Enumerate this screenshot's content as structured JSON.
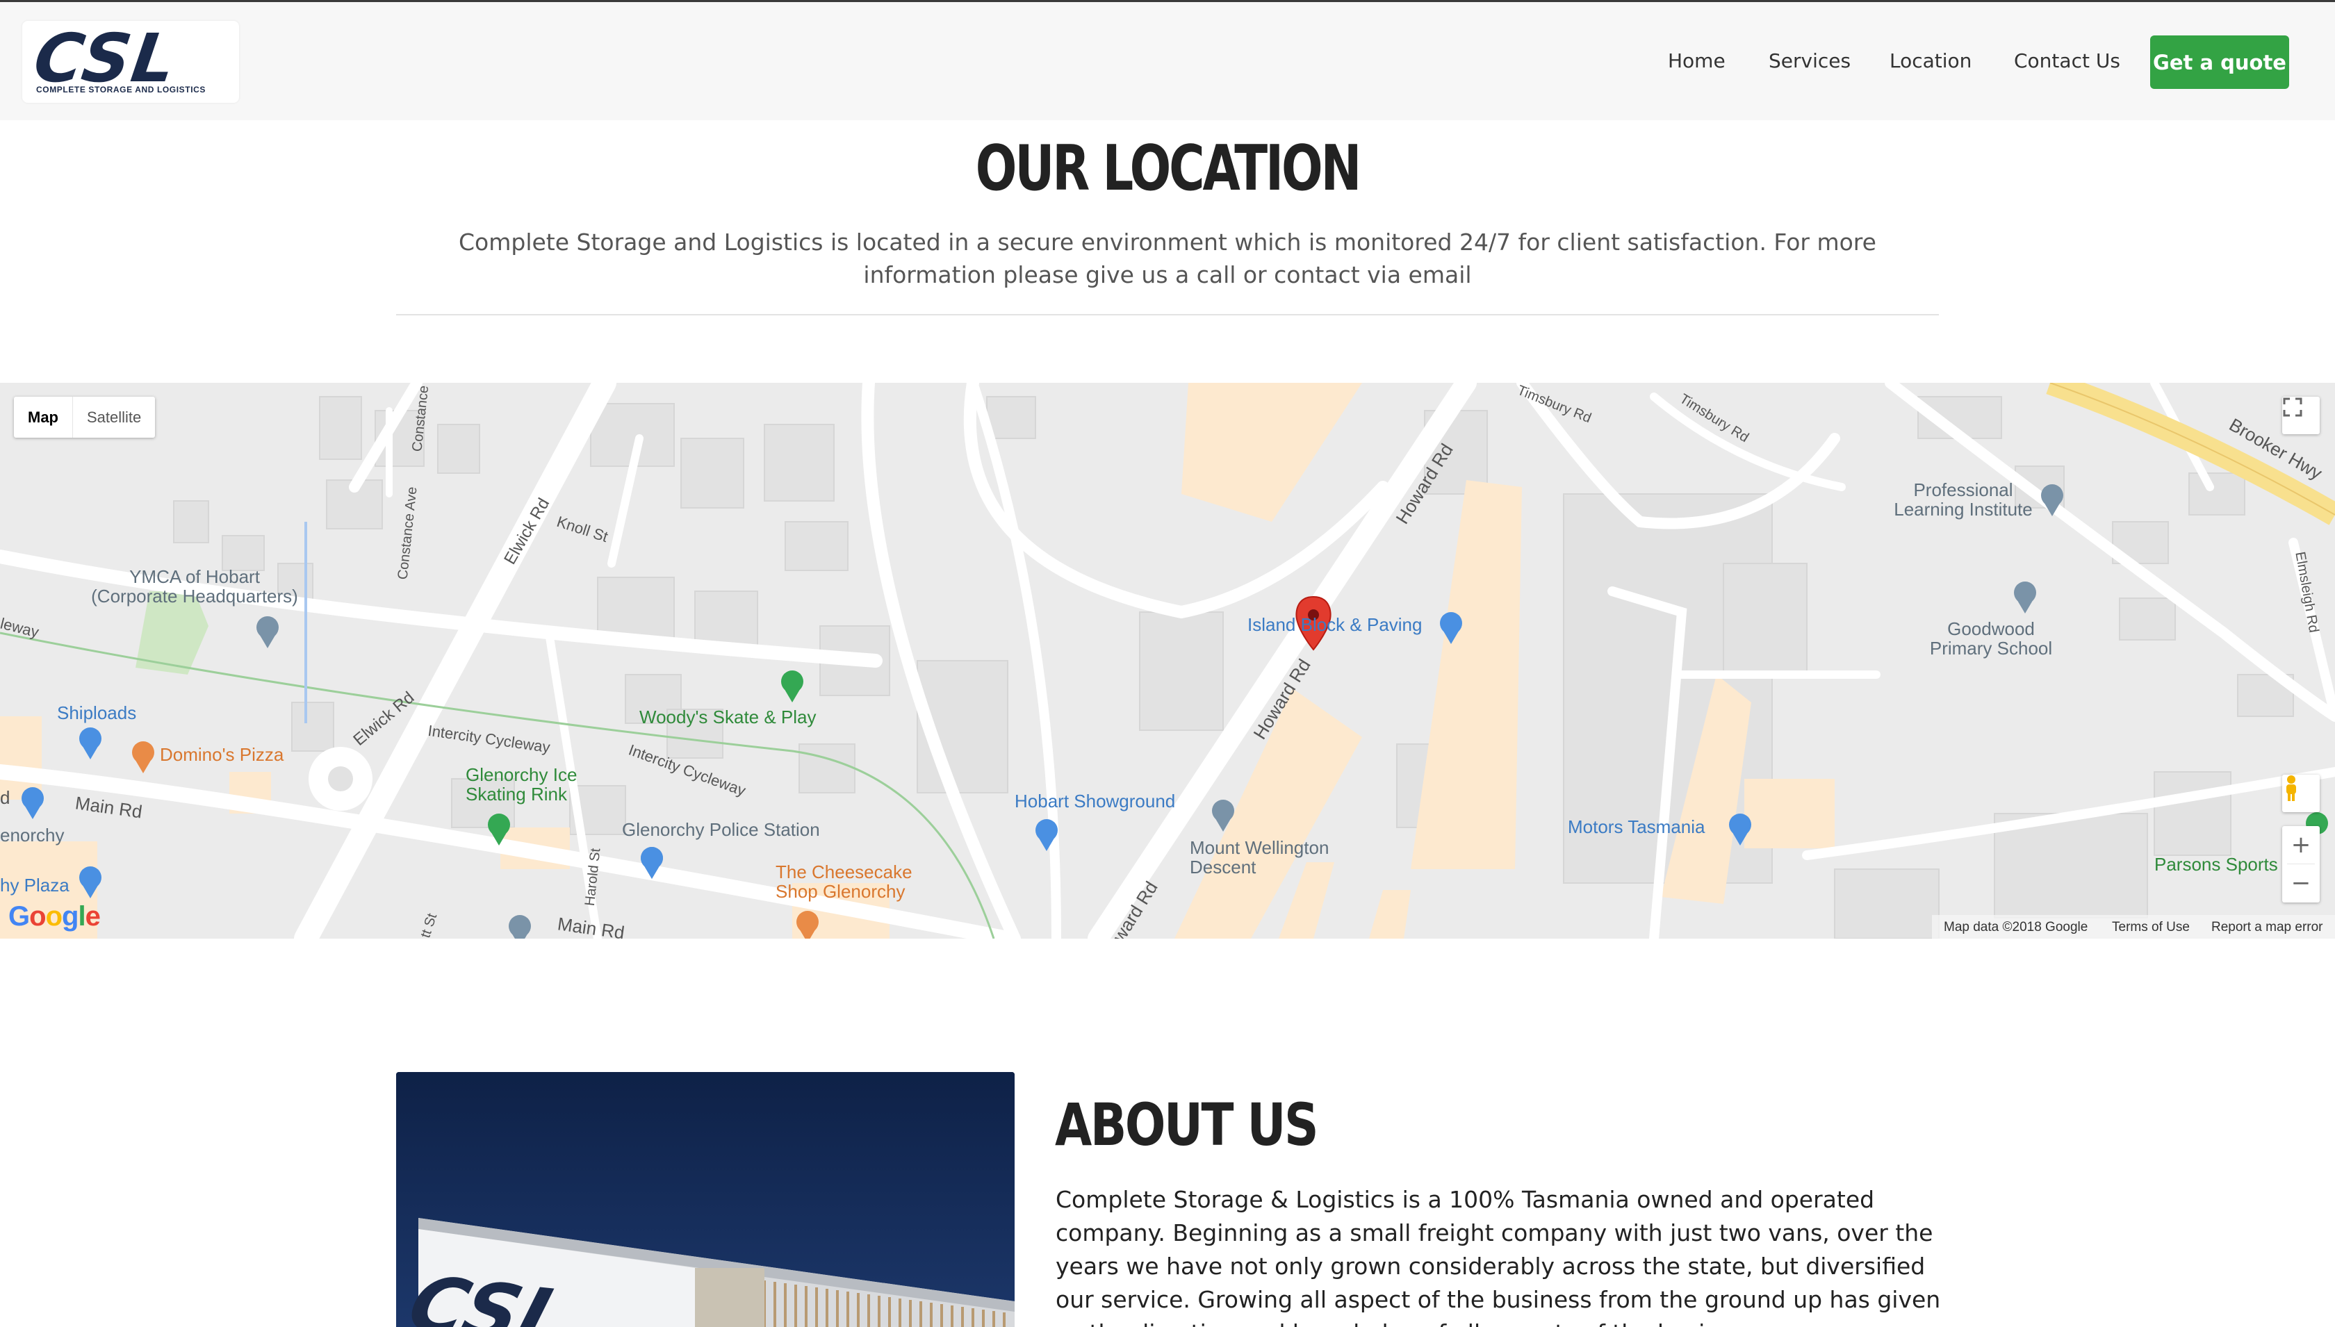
{
  "header": {
    "logo_text": "CSL",
    "logo_subtitle": "COMPLETE STORAGE AND LOGISTICS",
    "nav": [
      "Home",
      "Services",
      "Location",
      "Contact Us"
    ],
    "cta_label": "Get a quote"
  },
  "location": {
    "title": "OUR LOCATION",
    "description": "Complete Storage and Logistics is located in a secure environment which is monitored 24/7 for client satisfaction. For more information please give us a call or contact via email"
  },
  "map": {
    "type_options": [
      "Map",
      "Satellite"
    ],
    "selected_type": "Map",
    "attribution": "Map data ©2018 Google",
    "terms_label": "Terms of Use",
    "report_label": "Report a map error",
    "google_logo": "Google",
    "zoom_in": "+",
    "zoom_out": "−",
    "marker_name": "red-location-pin",
    "labels": {
      "ymca": "YMCA of Hobart\n(Corporate Headquarters)",
      "shiploads": "Shiploads",
      "dominos": "Domino's Pizza",
      "woodys": "Woody's Skate & Play",
      "glenorchy_ice": "Glenorchy Ice\nSkating Rink",
      "police": "Glenorchy Police Station",
      "cheesecake": "The Cheesecake\nShop Glenorchy",
      "hobart_showground": "Hobart Showground",
      "mount_wellington": "Mount Wellington\nDescent",
      "island_block": "Island Block & Paving",
      "motors_tas": "Motors Tasmania",
      "professional": "Professional\nLearning Institute",
      "goodwood": "Goodwood\nPrimary School",
      "parsons": "Parsons Sports",
      "elwick_rd_1": "Elwick Rd",
      "elwick_rd_2": "Elwick Rd",
      "knoll_st": "Knoll St",
      "constance_ave": "Constance Ave",
      "intercity_1": "Intercity Cycleway",
      "intercity_2": "Intercity Cycleway",
      "main_rd_1": "Main Rd",
      "main_rd_2": "Main Rd",
      "harold_st": "Harold St",
      "howard_rd_1": "Howard Rd",
      "howard_rd_2": "Howard Rd",
      "howard_rd_3": "Howard Rd",
      "timsbury_1": "Timsbury Rd",
      "timsbury_2": "Timsbury Rd",
      "brooker": "Brooker Hwy",
      "elmsleigh": "Elmsleigh Rd",
      "glenorchy_left": "enorchy",
      "plaza_left": "hy Plaza",
      "d_left": "d",
      "leeway": "leway",
      "st_bottom": "tt St",
      "constance_top": "Constance"
    }
  },
  "about": {
    "title": "ABOUT US",
    "text": "Complete Storage & Logistics is a 100% Tasmania owned and operated company. Beginning as a small freight company with just two vans, over the years we have not only grown considerably across the state, but diversified our service. Growing all aspect of the business from the ground up has given us the direction and knowledge of all aspects of the business.",
    "photo_sign_text": "CSL"
  }
}
